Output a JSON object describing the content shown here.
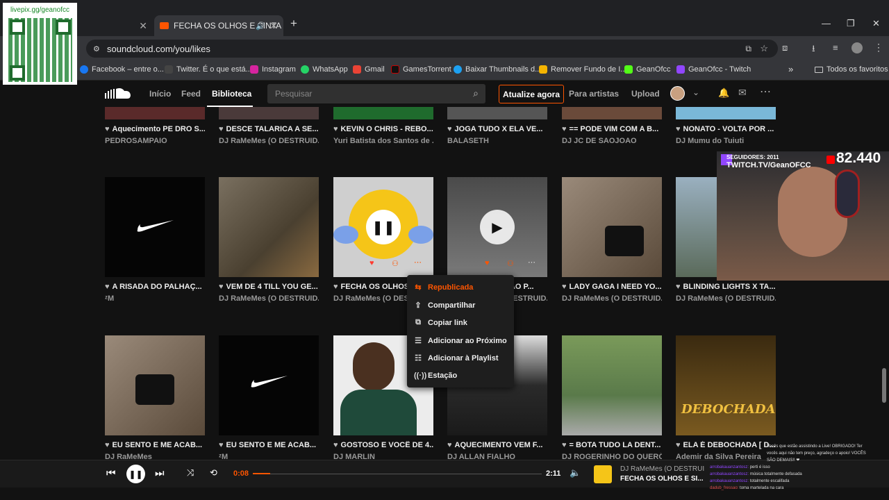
{
  "browser": {
    "tabs": [
      {
        "label": ""
      },
      {
        "label": "FECHA OS OLHOS E SINTA"
      }
    ],
    "url": "soundcloud.com/you/likes",
    "bookmarks": [
      {
        "label": "Facebook – entre o...",
        "color": "#1877f2"
      },
      {
        "label": "Twitter. É o que está...",
        "color": "#444"
      },
      {
        "label": "Instagram",
        "color": "#d6249f"
      },
      {
        "label": "WhatsApp",
        "color": "#25d366"
      },
      {
        "label": "Gmail",
        "color": "#ea4335"
      },
      {
        "label": "GamesTorrent",
        "color": "#222"
      },
      {
        "label": "Baixar Thumbnails d...",
        "color": "#1da1f2"
      },
      {
        "label": "Remover Fundo de I...",
        "color": "#f5b400"
      },
      {
        "label": "GeanOfcc",
        "color": "#53fc18"
      },
      {
        "label": "GeanOfcc - Twitch",
        "color": "#9146ff"
      }
    ],
    "all_favorites": "Todos os favoritos"
  },
  "overlay": {
    "livepix": "livepix.gg/geanofcc"
  },
  "header": {
    "nav": [
      "Início",
      "Feed",
      "Biblioteca"
    ],
    "search_placeholder": "Pesquisar",
    "upgrade": "Atualize agora",
    "for_artists": "Para artistas",
    "upload": "Upload"
  },
  "rows": [
    [
      {
        "title": "Aquecimento PE DRO S...",
        "artist": "PEDROSAMPAIO",
        "color": "#5a2a2a"
      },
      {
        "title": "DESCE TALARICA A SE...",
        "artist": "DJ RaMeMes (O DESTRUID...",
        "color": "#4a3a3a"
      },
      {
        "title": "KEVIN O CHRIS - REBO...",
        "artist": "Yuri Batista dos Santos de ...",
        "color": "#1f6b2d"
      },
      {
        "title": "JOGA TUDO X ELA VE...",
        "artist": "BALASETH",
        "color": "#555"
      },
      {
        "title": "== PODE VIM COM A B...",
        "artist": "DJ JC DE SAOJOAO",
        "color": "#6a4a3a"
      },
      {
        "title": "NONATO - VOLTA POR ...",
        "artist": "DJ Mumu do Tuiuti",
        "color": "#7ab8d8"
      }
    ],
    [
      {
        "title": "A RISADA DO PALHAÇ...",
        "artist": "ᶻM",
        "color": "#050505"
      },
      {
        "title": "VEM DE 4 TILL YOU GE...",
        "artist": "DJ RaMeMes (O DESTRUID...",
        "color": "#5a5040"
      },
      {
        "title": "FECHA OS OLHOS",
        "artist": "DJ RaMeMes (O DEST",
        "color": "#cfcfcf"
      },
      {
        "title": "AMOR BANDIDÃO P...",
        "artist": "DJ RaMeMes (O DESTRUID...",
        "color": "#6a6a6a"
      },
      {
        "title": "LADY GAGA I NEED YO...",
        "artist": "DJ RaMeMes (O DESTRUID...",
        "color": "#8a7a6a"
      },
      {
        "title": "BLINDING LIGHTS X TA...",
        "artist": "DJ RaMeMes (O DESTRUID...",
        "color": "#6a7a6a"
      }
    ],
    [
      {
        "title": "EU SENTO E ME ACAB...",
        "artist": "DJ RaMeMes",
        "color": "#8a7a6a"
      },
      {
        "title": "EU SENTO E ME ACAB...",
        "artist": "ᶻM",
        "color": "#050505"
      },
      {
        "title": "GOSTOSO E VOCÊ DE 4...",
        "artist": "DJ MARLIN",
        "color": "#e8e8e8"
      },
      {
        "title": "AQUECIMENTO VEM F...",
        "artist": "DJ ALLAN FIALHO",
        "color": "#3a3a3a"
      },
      {
        "title": "= BOTA TUDO LA DENT...",
        "artist": "DJ ROGERINHO DO QUERÔ",
        "color": "#6a7a5a"
      },
      {
        "title": "ELA É DEBOCHADA [ D...",
        "artist": "Ademir da Silva Pereira",
        "color": "#5a4a1a"
      }
    ]
  ],
  "context_menu": [
    "Republicada",
    "Compartilhar",
    "Copiar link",
    "Adicionar ao Próximo",
    "Adicionar à Playlist",
    "Estação"
  ],
  "stream": {
    "followers": "SEGUIDORES: 2011",
    "channel": "TWITCH.TV/GeanOFCC",
    "count": "82.440"
  },
  "player": {
    "elapsed": "0:08",
    "duration": "2:11",
    "progress": 0.06,
    "artist": "DJ RaMeMes (O DESTRUI",
    "title": "FECHA OS OLHOS E SI..."
  },
  "chat": [
    {
      "user": "",
      "msg": "Vocês que estão assistindo a Live! OBRIGADO! Ter"
    },
    {
      "user": "",
      "msg": "vocês aqui não tem preço, agradeço o apoio! VOCÊS"
    },
    {
      "user": "",
      "msg": "SÃO DEMAIS!! ❤"
    },
    {
      "user": "arrobakauanzantosz:",
      "msg": "perti é isso"
    },
    {
      "user": "arrobakauanzantosz:",
      "msg": "música totalmente defasada"
    },
    {
      "user": "arrobakauanzantosz:",
      "msg": "totalmente escalifada"
    },
    {
      "user": "dadub_fressao:",
      "msg": "toma martelada na cara"
    }
  ]
}
